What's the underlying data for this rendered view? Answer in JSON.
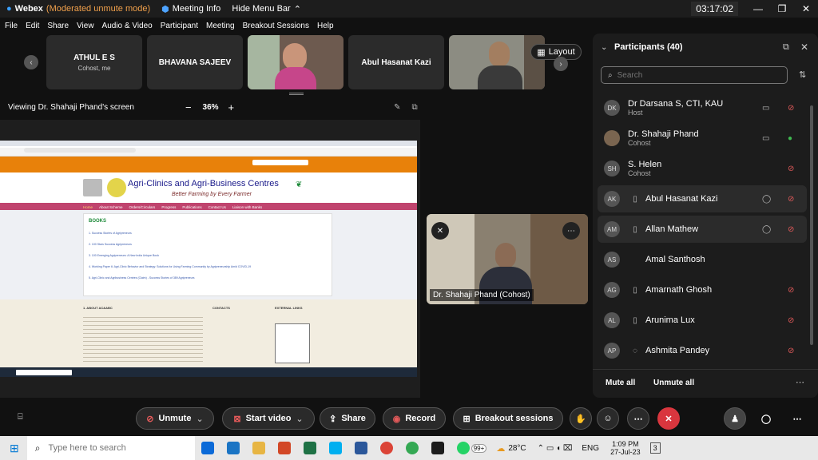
{
  "titlebar": {
    "app_name": "Webex",
    "mode": "(Moderated unmute mode)",
    "meeting_info": "Meeting Info",
    "hide_menu": "Hide Menu Bar",
    "timer": "03:17:02"
  },
  "menu": [
    "File",
    "Edit",
    "Share",
    "View",
    "Audio & Video",
    "Participant",
    "Meeting",
    "Breakout Sessions",
    "Help"
  ],
  "thumbnails": [
    {
      "name": "ATHUL E S",
      "sub": "Cohost, me"
    },
    {
      "name": "BHAVANA SAJEEV",
      "sub": ""
    },
    {
      "name": "",
      "sub": ""
    },
    {
      "name": "Abul Hasanat Kazi",
      "sub": ""
    },
    {
      "name": "",
      "sub": ""
    }
  ],
  "layout_label": "Layout",
  "share": {
    "viewing": "Viewing Dr. Shahaji Phand's screen",
    "zoom_minus": "−",
    "zoom": "36%",
    "zoom_plus": "+"
  },
  "website": {
    "title_line1": "Agri-Clinics and Agri-Business Centres",
    "tagline": "Better Farming by Every Farmer",
    "menu": [
      "Home",
      "About Scheme",
      "Orders/Circulars",
      "Progress",
      "Publications",
      "Contact Us",
      "Liaison with Banks"
    ],
    "books_heading": "BOOKS",
    "books": [
      "1. Success Stories of Agripreneurs",
      "2. 100 Stars Success Agripreneurs",
      "3. 100 Emerging Agripreneurs: A New India Unique Book",
      "4. Working Paper 6: Agri-Clinic Behavior and Strategy: Solutions for Using Farming Community by Agripreneurship Amid COVID-19",
      "5. Agri-Clinic and Agribusiness Centres (Claim) - Success Stories of 389 Agripreneurs"
    ],
    "footer_about": "1. ABOUT AC&ABC",
    "footer_contacts": "CONTACTS",
    "footer_links": "EXTERNAL LINKS"
  },
  "self_video_label": "Dr. Shahaji Phand (Cohost)",
  "panel": {
    "title": "Participants (40)",
    "search_placeholder": "Search",
    "participants": [
      {
        "initials": "DK",
        "name": "Dr Darsana S, CTI, KAU",
        "role": "Host",
        "mic": "muted"
      },
      {
        "initials": "DS",
        "name": "Dr. Shahaji Phand",
        "role": "Cohost",
        "mic": "active"
      },
      {
        "initials": "SH",
        "name": "S. Helen",
        "role": "Cohost",
        "mic": "muted"
      },
      {
        "initials": "AK",
        "name": "Abul Hasanat Kazi",
        "role": "",
        "mic": "muted"
      },
      {
        "initials": "AM",
        "name": "Allan Mathew",
        "role": "",
        "mic": "muted"
      },
      {
        "initials": "AS",
        "name": "Amal Santhosh",
        "role": "",
        "mic": "none"
      },
      {
        "initials": "AG",
        "name": "Amarnath Ghosh",
        "role": "",
        "mic": "muted"
      },
      {
        "initials": "AL",
        "name": "Arunima Lux",
        "role": "",
        "mic": "muted"
      },
      {
        "initials": "AP",
        "name": "Ashmita Pandey",
        "role": "",
        "mic": "muted"
      }
    ],
    "mute_all": "Mute all",
    "unmute_all": "Unmute all"
  },
  "controls": {
    "unmute": "Unmute",
    "start_video": "Start video",
    "share": "Share",
    "record": "Record",
    "breakout": "Breakout sessions"
  },
  "taskbar": {
    "search_placeholder": "Type here to search",
    "badge": "99+",
    "temp": "28°C",
    "lang": "ENG",
    "time": "1:09 PM",
    "date": "27-Jul-23",
    "notif": "3"
  },
  "colors": {
    "accent_orange": "#e8810a",
    "nav_pink": "#c0446e",
    "mute_red": "#e35a5a",
    "leave_red": "#d9363e"
  }
}
